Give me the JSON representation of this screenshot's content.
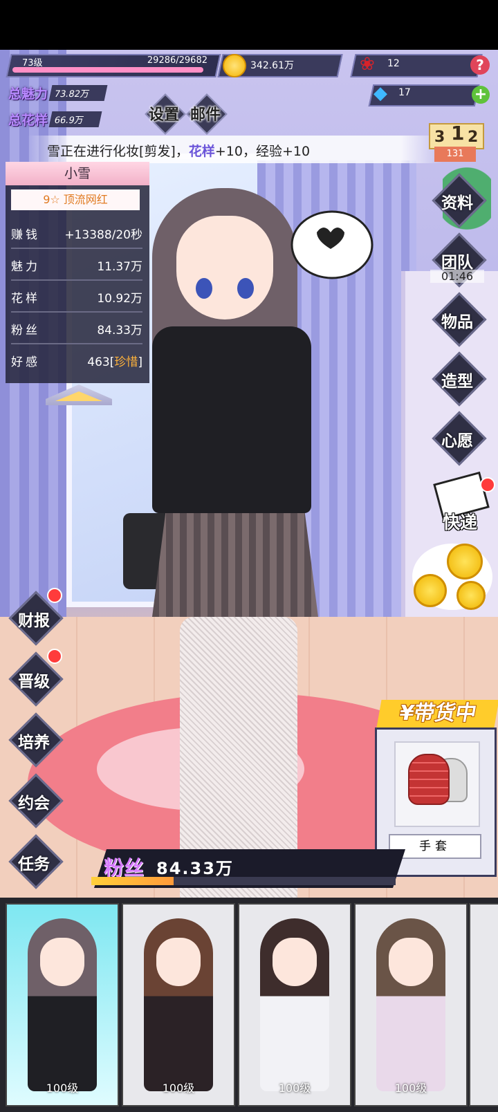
{
  "colors": {
    "accent": "#6a54d9",
    "fans": "#d77cff",
    "gold": "#ffb23a"
  },
  "top": {
    "level": "73级",
    "exp": "29286/29682",
    "exp_progress": 0.987,
    "gold": "342.61万",
    "roses": "12",
    "gems": "17",
    "help_icon": "?",
    "plus_icon": "+",
    "rank_number": "131",
    "podium": [
      "3",
      "1",
      "2"
    ]
  },
  "stats": [
    {
      "label": "总魅力",
      "value": "73.82万"
    },
    {
      "label": "总花样",
      "value": "66.9万"
    }
  ],
  "top_buttons": [
    {
      "label": "设置"
    },
    {
      "label": "邮件"
    }
  ],
  "message": {
    "prefix": "雪正在进行化妆[剪发]，",
    "highlight": "花样",
    "suffix": "+10，经验+10"
  },
  "character": {
    "name": "小雪",
    "title": "9☆ 顶流网红",
    "rows": [
      {
        "label": "赚钱",
        "value": "+13388/20秒",
        "highlight": ""
      },
      {
        "label": "魅力",
        "value": "11.37万",
        "highlight": ""
      },
      {
        "label": "花样",
        "value": "10.92万",
        "highlight": ""
      },
      {
        "label": "粉丝",
        "value": "84.33万",
        "highlight": ""
      },
      {
        "label": "好感",
        "value": "463[",
        "highlight": "珍惜",
        "suffix": "]"
      }
    ]
  },
  "right_menu": [
    {
      "label": "资料",
      "timer": ""
    },
    {
      "label": "团队",
      "timer": "01:46"
    },
    {
      "label": "物品",
      "timer": ""
    },
    {
      "label": "造型",
      "timer": ""
    },
    {
      "label": "心愿",
      "timer": ""
    }
  ],
  "express": {
    "label": "快递"
  },
  "left_menu": [
    {
      "label": "财报",
      "badge": true
    },
    {
      "label": "晋级",
      "badge": true
    },
    {
      "label": "培养",
      "badge": false
    },
    {
      "label": "约会",
      "badge": false
    },
    {
      "label": "任务",
      "badge": false
    }
  ],
  "selling": {
    "title": "¥带货中",
    "item": "手套"
  },
  "fans": {
    "label": "粉丝",
    "value": "84.33万",
    "progress": 0.27
  },
  "roster": [
    {
      "level": "100级",
      "hair": "#6f6068",
      "outfit": "#1f1f24",
      "selected": true
    },
    {
      "level": "100级",
      "hair": "#6a4334",
      "outfit": "#2b2226",
      "selected": false
    },
    {
      "level": "100级",
      "hair": "#3e2d2c",
      "outfit": "#f2f2f6",
      "selected": false
    },
    {
      "level": "100级",
      "hair": "#6a5447",
      "outfit": "#e9d9ea",
      "selected": false
    }
  ]
}
